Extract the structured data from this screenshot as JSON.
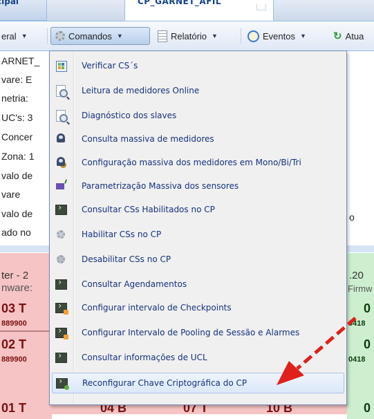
{
  "tabs": [
    {
      "label": "cipal"
    },
    {
      "label": "CP_GARNET_AFIL"
    }
  ],
  "toolbar": {
    "buttons": [
      {
        "label": "eral"
      },
      {
        "label": "Comandos"
      },
      {
        "label": "Relatório"
      },
      {
        "label": "Eventos"
      },
      {
        "label": "Atua"
      }
    ]
  },
  "background": {
    "left_labels": [
      "ARNET_",
      "vare: E",
      "netria:",
      "UC's: 3",
      "Concer",
      "Zona: 1",
      "valo de",
      "vare",
      "valo de",
      "ado no"
    ],
    "right_o": "o",
    "row1_left": "ter - 2",
    "row1_left2": "nware:",
    "row1_right": ".20",
    "row1_right2": "Firmw",
    "row2": [
      "03 T",
      "0"
    ],
    "row2_small": [
      "889900",
      "0418"
    ],
    "row3": [
      "02 T",
      "0"
    ],
    "row3_small": [
      "889900",
      "0418"
    ],
    "row4": [
      "01 T",
      "04 B",
      "07 T",
      "10 B",
      "0"
    ]
  },
  "menu": {
    "items": [
      {
        "label": "Verificar CS´s",
        "icon": "grid-check-icon"
      },
      {
        "label": "Leitura de medidores Online",
        "icon": "document-magnifier-icon"
      },
      {
        "label": "Diagnóstico dos slaves",
        "icon": "document-magnifier-icon"
      },
      {
        "label": "Consulta massiva de medidores",
        "icon": "meter-icon"
      },
      {
        "label": "Configuração massiva dos medidores em Mono/Bi/Tri",
        "icon": "meter-config-icon"
      },
      {
        "label": "Parametrização Massiva dos sensores",
        "icon": "sensor-param-icon"
      },
      {
        "label": "Consultar CSs Habilitados no CP",
        "icon": "terminal-icon"
      },
      {
        "label": "Habilitar CSs no CP",
        "icon": "gear-icon"
      },
      {
        "label": "Desabilitar CSs no CP",
        "icon": "gear-icon"
      },
      {
        "label": "Consultar Agendamentos",
        "icon": "terminal-icon"
      },
      {
        "label": "Configurar intervalo de Checkpoints",
        "icon": "terminal-config-icon"
      },
      {
        "label": "Configurar Intervalo de Pooling de Sessão e Alarmes",
        "icon": "terminal-config-icon"
      },
      {
        "label": "Consultar informações de UCL",
        "icon": "terminal-icon"
      },
      {
        "label": "Reconfigurar Chave Criptográfica do CP",
        "icon": "terminal-ok-icon"
      }
    ]
  },
  "colors": {
    "menu_text": "#15317e",
    "annotation_arrow": "#e0201b",
    "cell_pink": "#f6c4c4",
    "cell_green": "#cdeecf"
  }
}
